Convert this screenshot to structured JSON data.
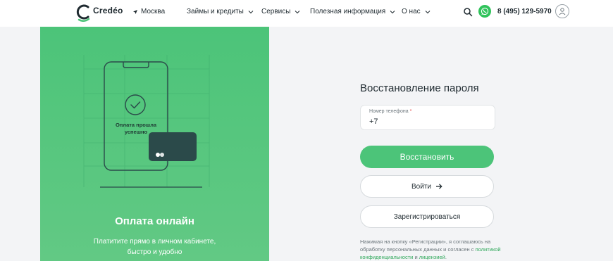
{
  "header": {
    "logo_text": "Credéo",
    "city": "Москва",
    "nav": [
      {
        "label": "Займы и кредиты"
      },
      {
        "label": "Сервисы"
      },
      {
        "label": "Полезная информация"
      },
      {
        "label": "О нас"
      }
    ],
    "phone": "8 (495) 129-5970"
  },
  "promo": {
    "illustration_text": "Оплата прошла успешно",
    "title": "Оплата онлайн",
    "subtitle_line1": "Платитите прямо в личном кабинете,",
    "subtitle_line2": "быстро и удобно"
  },
  "form": {
    "title": "Восстановление пароля",
    "phone_label": "Номер телефона",
    "phone_required_mark": "*",
    "phone_value": "+7",
    "restore_button": "Восстановить",
    "login_button": "Войти",
    "register_button": "Зарегистрироваться",
    "consent_prefix": "Нажимая на кнопку «Регистрации», я соглашаюсь на обработку персональных данных и согласен с ",
    "consent_policy_link": "политикой конфиденциальности",
    "consent_and": " и ",
    "consent_license_link": "лицензией",
    "consent_suffix": "."
  },
  "colors": {
    "brand_green": "#4cc479",
    "whatsapp_green": "#30c35b",
    "card_dark": "#2b4a4a",
    "link_green": "#2fa85b"
  },
  "icons": {
    "logo": "credeo-logo-icon",
    "city": "location-arrow-icon",
    "search": "search-icon",
    "whatsapp": "whatsapp-icon",
    "user": "user-icon",
    "login_arrow": "arrow-right-icon"
  }
}
